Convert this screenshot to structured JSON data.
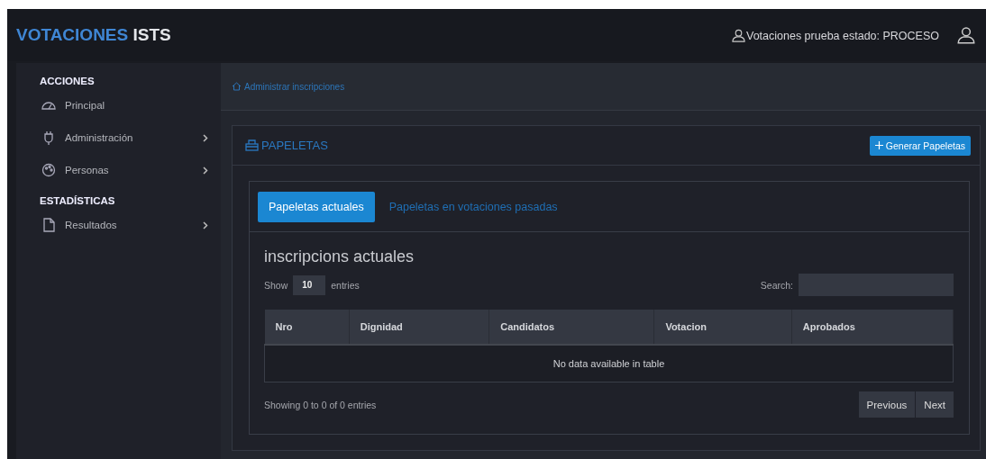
{
  "header": {
    "brand_main": "VOTACIONES",
    "brand_rest": "ISTS",
    "status": "Votaciones prueba estado: PROCESO"
  },
  "sidebar": {
    "sections": [
      {
        "title": "ACCIONES",
        "items": [
          {
            "label": "Principal",
            "expandable": false
          },
          {
            "label": "Administración",
            "expandable": true
          },
          {
            "label": "Personas",
            "expandable": true
          }
        ]
      },
      {
        "title": "ESTADÍSTICAS",
        "items": [
          {
            "label": "Resultados",
            "expandable": true
          }
        ]
      }
    ]
  },
  "breadcrumb": "Administrar inscripciones",
  "card": {
    "title": "PAPELETAS",
    "action": "Generar Papeletas"
  },
  "tabs": [
    {
      "label": "Papeletas actuales",
      "selected": true
    },
    {
      "label": "Papeletas en votaciones pasadas",
      "selected": false
    }
  ],
  "table": {
    "title": "inscripcions actuales",
    "show_label": "Show",
    "length": "10",
    "entries_label": "entries",
    "search_label": "Search:",
    "columns": [
      "Nro",
      "Dignidad",
      "Candidatos",
      "Votacion",
      "Aprobados"
    ],
    "empty": "No data available in table",
    "info": "Showing 0 to 0 of 0 entries",
    "pagination": [
      "Previous",
      "Next"
    ]
  }
}
